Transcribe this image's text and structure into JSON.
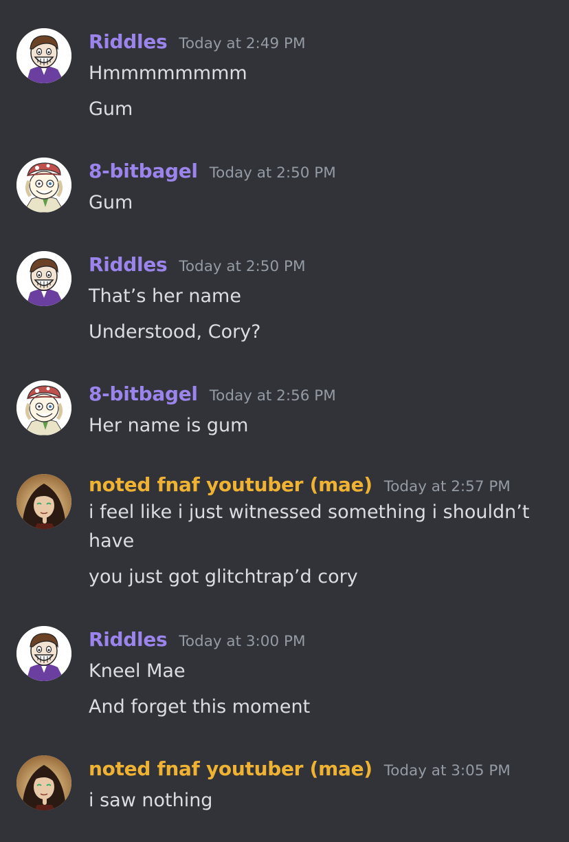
{
  "colors": {
    "background": "#313338",
    "riddles_name": "#9b84ec",
    "bagel_name": "#9b84ec",
    "mae_name": "#f0b232",
    "timestamp": "#949ba4",
    "text": "#dbdee1"
  },
  "messages": [
    {
      "author": "Riddles",
      "timestamp": "Today at 2:49 PM",
      "avatar": "riddles-avatar",
      "lines": [
        "Hmmmmmmmm",
        "Gum"
      ]
    },
    {
      "author": "8-bitbagel",
      "timestamp": "Today at 2:50 PM",
      "avatar": "bagel-avatar",
      "lines": [
        "Gum"
      ]
    },
    {
      "author": "Riddles",
      "timestamp": "Today at 2:50 PM",
      "avatar": "riddles-avatar",
      "lines": [
        "That’s her name",
        "Understood, Cory?"
      ]
    },
    {
      "author": "8-bitbagel",
      "timestamp": "Today at 2:56 PM",
      "avatar": "bagel-avatar",
      "lines": [
        "Her name is gum"
      ]
    },
    {
      "author": "noted fnaf youtuber (mae)",
      "timestamp": "Today at 2:57 PM",
      "avatar": "mae-avatar",
      "lines": [
        "i feel like i just witnessed something i shouldn’t have",
        "you just got glitchtrap’d cory"
      ]
    },
    {
      "author": "Riddles",
      "timestamp": "Today at 3:00 PM",
      "avatar": "riddles-avatar",
      "lines": [
        "Kneel Mae",
        "And forget this moment"
      ]
    },
    {
      "author": "noted fnaf youtuber (mae)",
      "timestamp": "Today at 3:05 PM",
      "avatar": "mae-avatar",
      "lines": [
        "i saw nothing"
      ]
    }
  ]
}
